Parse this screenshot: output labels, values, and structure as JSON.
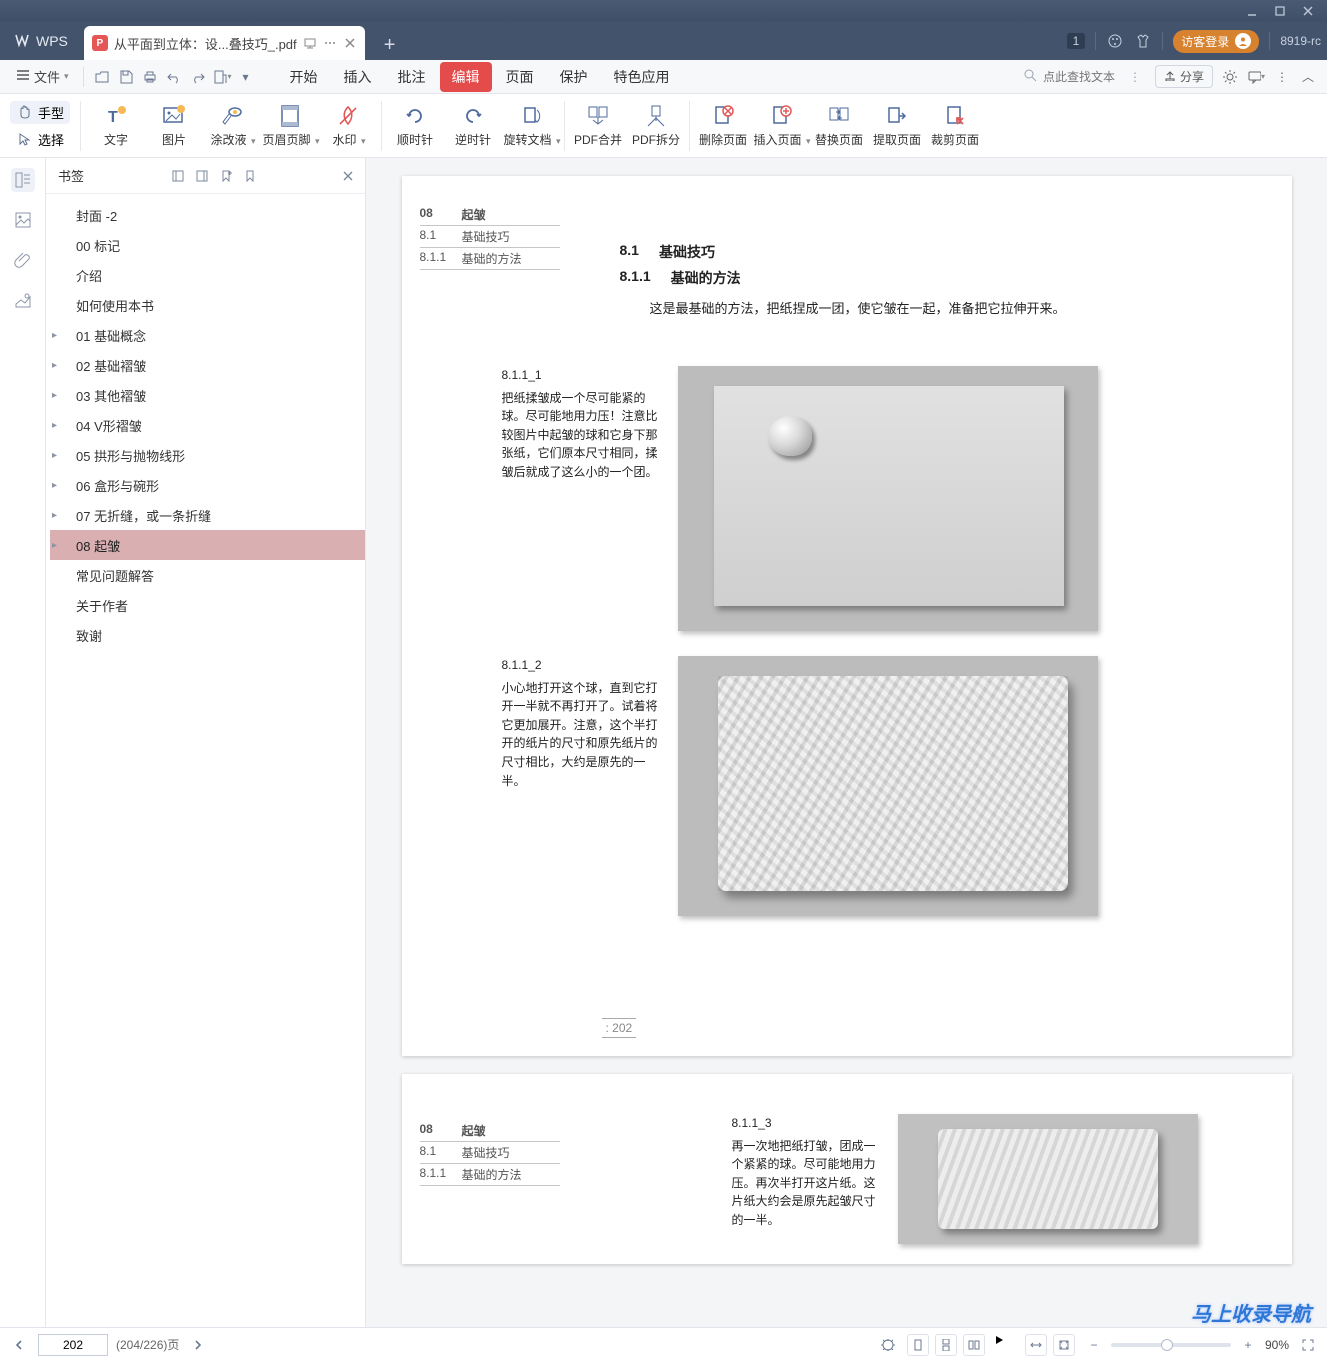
{
  "window": {
    "min": "–",
    "max": "▢",
    "close": "✕"
  },
  "tabstrip": {
    "home_label": "WPS",
    "tab_title": "从平面到立体：设...叠技巧_.pdf",
    "badge": "1",
    "login": "访客登录",
    "version": "8919-rc"
  },
  "menubar": {
    "file": "文件",
    "tabs": [
      "开始",
      "插入",
      "批注",
      "编辑",
      "页面",
      "保护",
      "特色应用"
    ],
    "active_tab_index": 3,
    "search_placeholder": "点此查找文本",
    "share": "分享"
  },
  "ribbon": {
    "tools_left": {
      "hand": "手型",
      "select": "选择"
    },
    "tools": [
      {
        "id": "text",
        "label": "文字"
      },
      {
        "id": "image",
        "label": "图片"
      },
      {
        "id": "redact",
        "label": "涂改液",
        "caret": true
      },
      {
        "id": "headerfooter",
        "label": "页眉页脚",
        "caret": true
      },
      {
        "id": "watermark",
        "label": "水印",
        "caret": true
      },
      {
        "id": "rot-cw",
        "label": "顺时针"
      },
      {
        "id": "rot-ccw",
        "label": "逆时针"
      },
      {
        "id": "rot-doc",
        "label": "旋转文档",
        "caret": true
      },
      {
        "id": "merge",
        "label": "PDF合并"
      },
      {
        "id": "split",
        "label": "PDF拆分"
      },
      {
        "id": "delete-page",
        "label": "删除页面"
      },
      {
        "id": "insert-page",
        "label": "插入页面",
        "caret": true
      },
      {
        "id": "replace-page",
        "label": "替换页面"
      },
      {
        "id": "extract-page",
        "label": "提取页面"
      },
      {
        "id": "crop-page",
        "label": "裁剪页面"
      }
    ],
    "sep_after": [
      4,
      7,
      9
    ]
  },
  "sidepanel": {
    "title": "书签",
    "items": [
      {
        "label": "封面 -2"
      },
      {
        "label": "00 标记"
      },
      {
        "label": "介绍"
      },
      {
        "label": "如何使用本书"
      },
      {
        "label": "01 基础概念",
        "children": true
      },
      {
        "label": "02 基础褶皱",
        "children": true
      },
      {
        "label": "03 其他褶皱",
        "children": true
      },
      {
        "label": "04 V形褶皱",
        "children": true
      },
      {
        "label": "05 拱形与抛物线形",
        "children": true
      },
      {
        "label": "06 盒形与碗形",
        "children": true
      },
      {
        "label": "07 无折缝，或一条折缝",
        "children": true
      },
      {
        "label": "08 起皱",
        "children": true,
        "active": true
      },
      {
        "label": "常见问题解答"
      },
      {
        "label": "关于作者"
      },
      {
        "label": "致谢"
      }
    ]
  },
  "document": {
    "page1": {
      "toc": [
        {
          "n": "08",
          "t": "起皱"
        },
        {
          "n": "8.1",
          "t": "基础技巧"
        },
        {
          "n": "8.1.1",
          "t": "基础的方法"
        }
      ],
      "h1": {
        "n": "8.1",
        "t": "基础技巧"
      },
      "h2": {
        "n": "8.1.1",
        "t": "基础的方法"
      },
      "desc": "这是最基础的方法，把纸捏成一团，使它皱在一起，准备把它拉伸开来。",
      "step1": {
        "id": "8.1.1_1",
        "text": "把纸揉皱成一个尽可能紧的球。尽可能地用力压！注意比较图片中起皱的球和它身下那张纸，它们原本尺寸相同，揉皱后就成了这么小的一个团。"
      },
      "step2": {
        "id": "8.1.1_2",
        "text": "小心地打开这个球，直到它打开一半就不再打开了。试着将它更加展开。注意，这个半打开的纸片的尺寸和原先纸片的尺寸相比，大约是原先的一半。"
      },
      "page_number": ": 202"
    },
    "page2": {
      "toc": [
        {
          "n": "08",
          "t": "起皱"
        },
        {
          "n": "8.1",
          "t": "基础技巧"
        },
        {
          "n": "8.1.1",
          "t": "基础的方法"
        }
      ],
      "step3": {
        "id": "8.1.1_3",
        "text": "再一次地把纸打皱，团成一个紧紧的球。尽可能地用力压。再次半打开这片纸。这片纸大约会是原先起皱尺寸的一半。"
      }
    }
  },
  "statusbar": {
    "page_input": "202",
    "page_count": "(204/226)页",
    "zoom": "90%",
    "thumb_left_pct": 42
  },
  "watermark": "马上收录导航"
}
